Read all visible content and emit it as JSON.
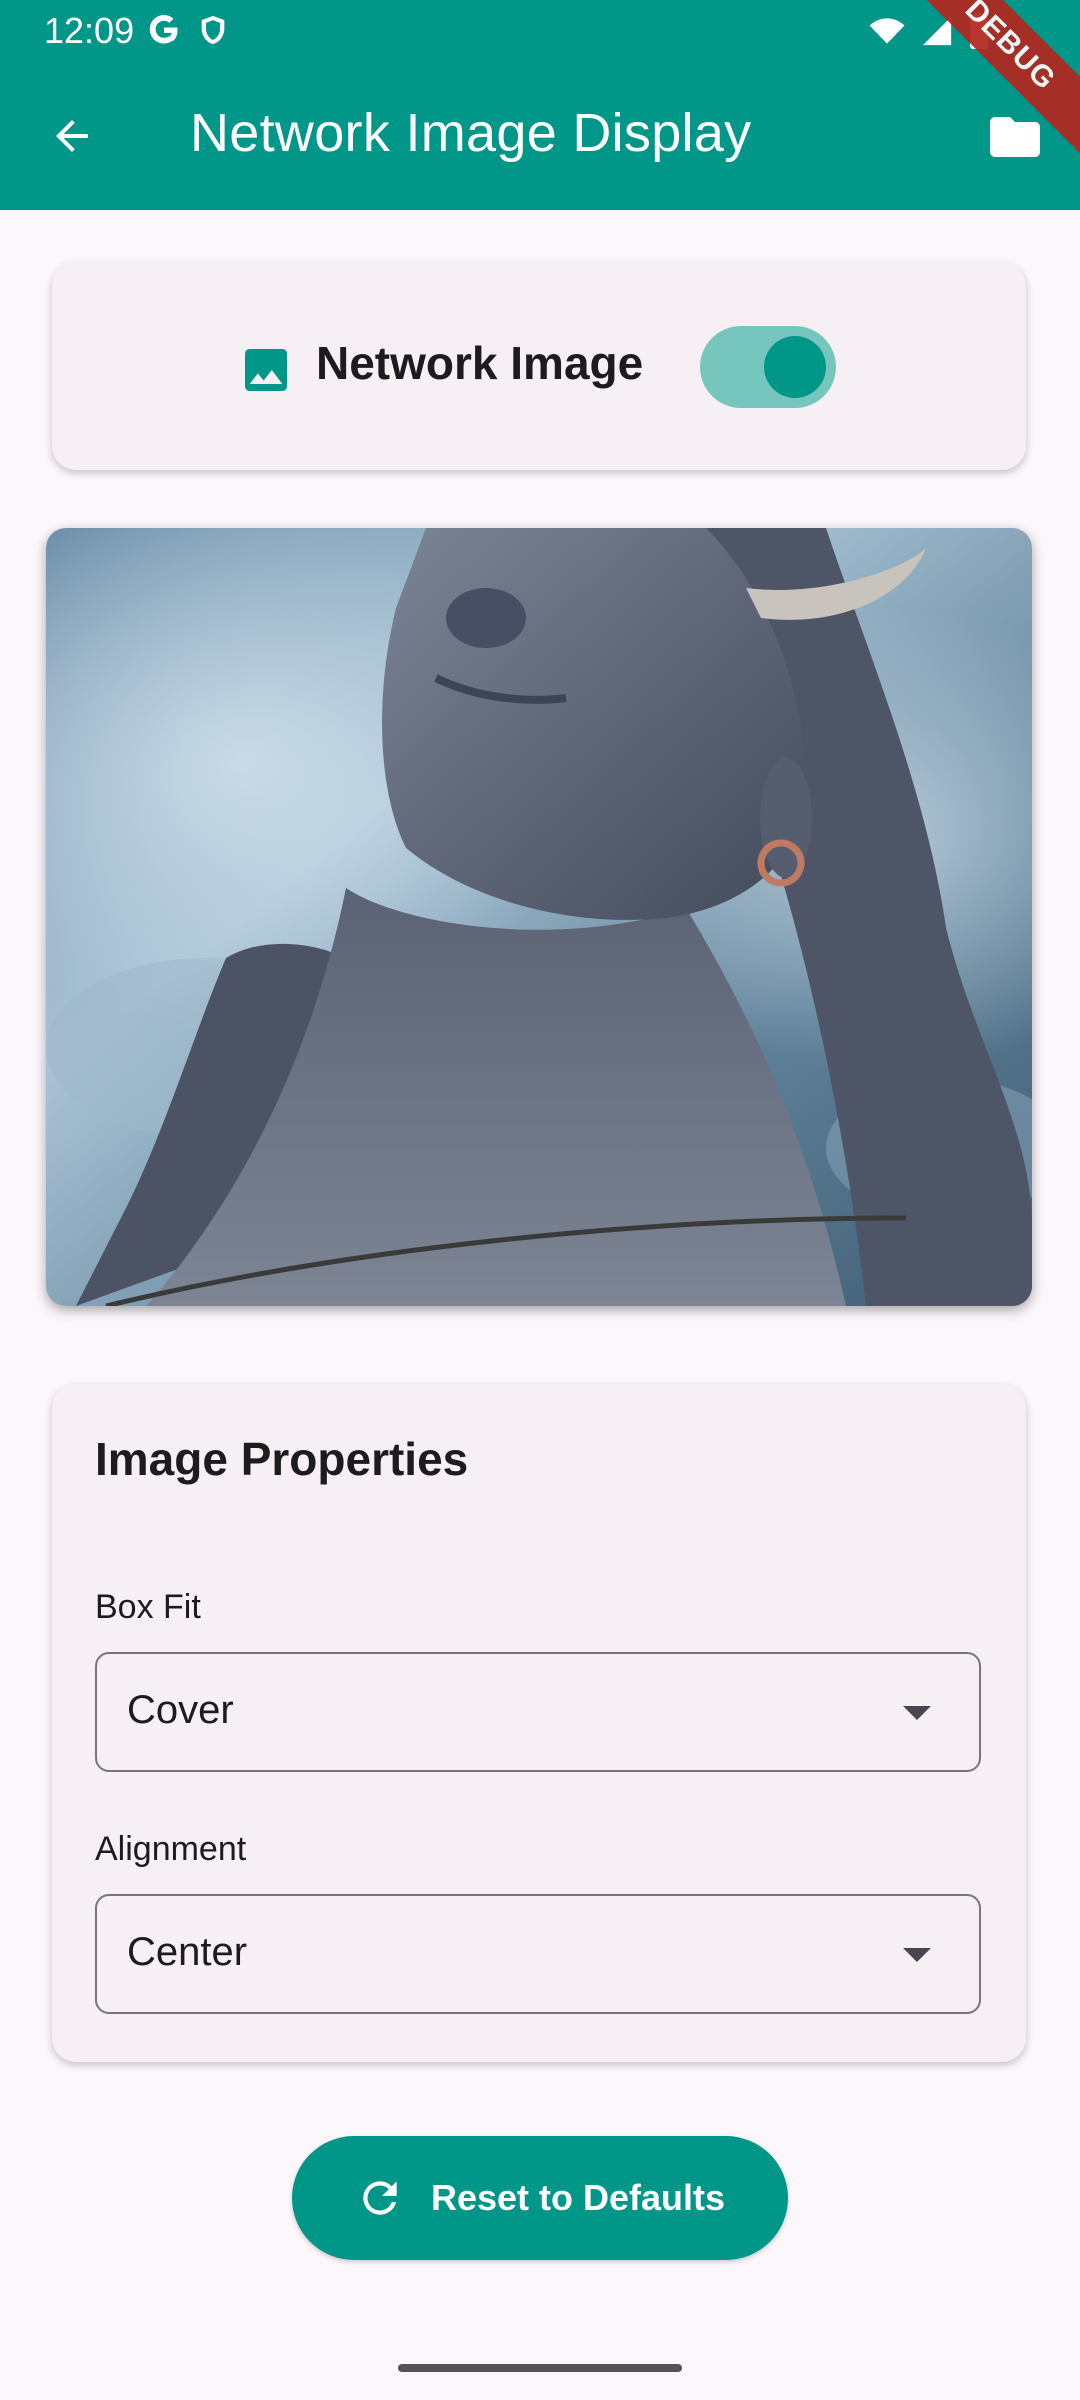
{
  "status_bar": {
    "time": "12:09"
  },
  "app_bar": {
    "title": "Network Image Display"
  },
  "debug_banner": "DEBUG",
  "toggle_card": {
    "label": "Network Image",
    "enabled": true
  },
  "properties": {
    "title": "Image Properties",
    "box_fit": {
      "label": "Box Fit",
      "value": "Cover"
    },
    "alignment": {
      "label": "Alignment",
      "value": "Center"
    }
  },
  "reset_button": {
    "label": "Reset to Defaults"
  },
  "colors": {
    "primary": "#009688",
    "background": "#FCF7FB",
    "card": "#F6F0F5",
    "switch_track": "#77C6BE"
  }
}
